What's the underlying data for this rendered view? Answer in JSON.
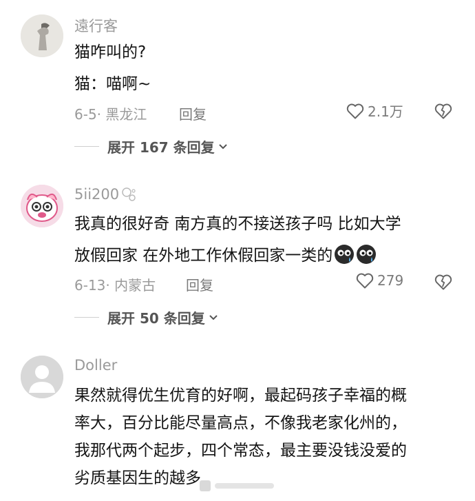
{
  "comments": [
    {
      "username": "遠行客",
      "lines": [
        "猫咋叫的?",
        "猫：喵啊~"
      ],
      "date_location": "6-5· 黑龙江",
      "reply_label": "回复",
      "likes": "2.1万",
      "expand_label": "展开 167 条回复"
    },
    {
      "username": "5ii200",
      "lines": [
        "我真的很好奇 南方真的不接送孩子吗 比如大学",
        "放假回家 在外地工作休假回家一类的"
      ],
      "date_location": "6-13· 内蒙古",
      "reply_label": "回复",
      "likes": "279",
      "expand_label": "展开 50 条回复"
    },
    {
      "username": "Doller",
      "lines": [
        "果然就得优生优育的好啊，最起码孩子幸福的概",
        "率大，百分比能尽量高点，不像我老家化州的，",
        "我那代两个起步，四个常态，最主要没钱没爱的",
        "劣质基因生的越多"
      ]
    }
  ],
  "icons": {
    "like": "heart-outline-icon",
    "dislike": "broken-heart-icon",
    "expand": "chevron-down-icon",
    "emoji": "crying-face-emoji-icon"
  }
}
